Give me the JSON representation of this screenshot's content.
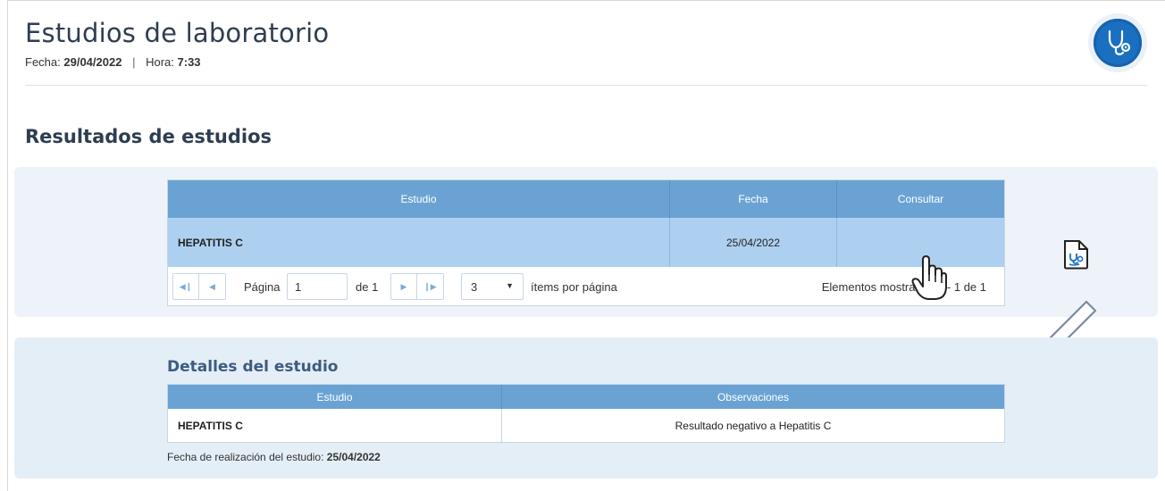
{
  "header": {
    "title": "Estudios de laboratorio",
    "fecha_label": "Fecha:",
    "fecha_value": "29/04/2022",
    "separator": "|",
    "hora_label": "Hora:",
    "hora_value": "7:33",
    "logo_icon": "stethoscope-icon"
  },
  "results": {
    "section_title": "Resultados de estudios",
    "columns": [
      "Estudio",
      "Fecha",
      "Consultar"
    ],
    "rows": [
      {
        "estudio": "HEPATITIS C",
        "fecha": "25/04/2022",
        "consultar_icon": "document-stethoscope-icon"
      }
    ],
    "pager": {
      "first_icon": "first-page-icon",
      "prev_icon": "prev-page-icon",
      "page_label": "Página",
      "page_value": "1",
      "of_label": "de 1",
      "next_icon": "next-page-icon",
      "last_icon": "last-page-icon",
      "page_size": "3",
      "items_label": "ítems por página",
      "info": "Elementos mostrados 1 - 1 de 1"
    }
  },
  "details": {
    "title": "Detalles del estudio",
    "columns": [
      "Estudio",
      "Observaciones"
    ],
    "rows": [
      {
        "estudio": "HEPATITIS C",
        "observaciones": "Resultado negativo a Hepatitis C"
      }
    ],
    "date_label": "Fecha de realización del estudio:",
    "date_value": "25/04/2022"
  },
  "colors": {
    "accent": "#6aa3d3",
    "selected_row": "#aed0f0",
    "panel_bg": "#edf3f8",
    "logo_bg": "#1a6fc0"
  }
}
